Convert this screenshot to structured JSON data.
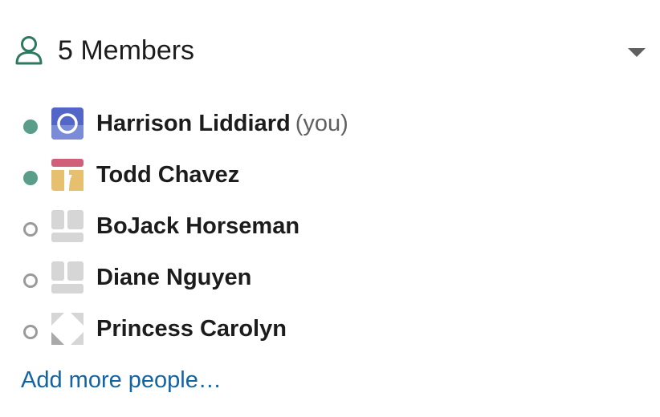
{
  "header": {
    "title": "5 Members",
    "icon": "person-outline-icon",
    "accent_color": "#2d7a5f",
    "toggle_icon": "caret-down-icon"
  },
  "members": [
    {
      "name": "Harrison Liddiard",
      "suffix": "(you)",
      "status": "online",
      "avatar": "avatar-blue-ring"
    },
    {
      "name": "Todd Chavez",
      "suffix": "",
      "status": "online",
      "avatar": "avatar-red-yellow-blocks"
    },
    {
      "name": "BoJack Horseman",
      "suffix": "",
      "status": "offline",
      "avatar": "avatar-gray-blocks"
    },
    {
      "name": "Diane Nguyen",
      "suffix": "",
      "status": "offline",
      "avatar": "avatar-gray-blocks"
    },
    {
      "name": "Princess Carolyn",
      "suffix": "",
      "status": "offline",
      "avatar": "avatar-gray-corners"
    }
  ],
  "add_more": {
    "label": "Add more people…"
  },
  "colors": {
    "online": "#5a9e8a",
    "offline": "#9a9a9a",
    "link": "#1264a3"
  }
}
